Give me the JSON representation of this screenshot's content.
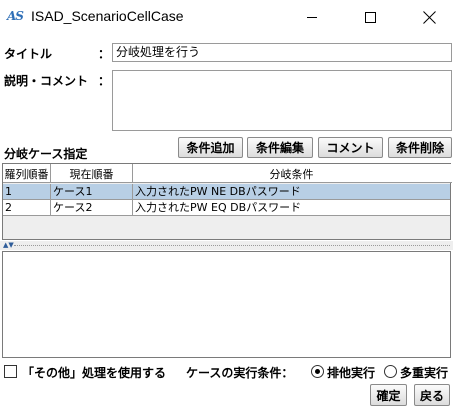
{
  "window": {
    "app_icon_text": "AS",
    "title": "ISAD_ScenarioCellCase"
  },
  "form": {
    "title_label": "タイトル",
    "colon": "：",
    "title_value": "分岐処理を行う",
    "desc_label": "説明・コメント",
    "desc_value": ""
  },
  "cases": {
    "section_label": "分岐ケース指定",
    "buttons": {
      "add": "条件追加",
      "edit": "条件編集",
      "comment": "コメント",
      "delete": "条件削除"
    },
    "columns": [
      "羅列順番",
      "現在順番",
      "分岐条件"
    ],
    "rows": [
      {
        "order": "1",
        "current": "ケース1",
        "condition": "入力されたPW NE DBパスワード",
        "selected": true
      },
      {
        "order": "2",
        "current": "ケース2",
        "condition": "入力されたPW EQ DBパスワード",
        "selected": false
      }
    ]
  },
  "options": {
    "other_label": "「その他」処理を使用する",
    "other_checked": false,
    "exec_label": "ケースの実行条件：",
    "exclusive_label": "排他実行",
    "multi_label": "多重実行",
    "selected_mode": "排他実行"
  },
  "footer": {
    "ok": "確定",
    "back": "戻る"
  },
  "colors": {
    "selected_row": "#b8cfe5",
    "window_bg": "#ffffff",
    "panel_bg": "#eeeeee"
  }
}
